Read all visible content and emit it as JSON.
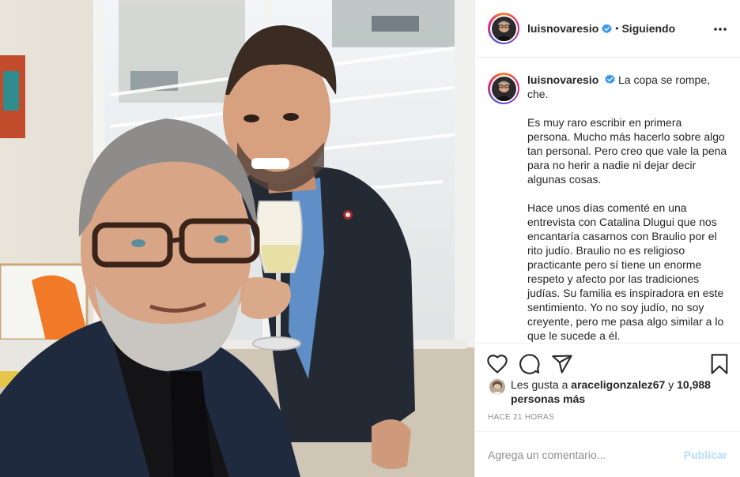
{
  "post": {
    "username": "luisnovaresio",
    "verified_icon": "verified-badge-icon",
    "separator": "•",
    "follow_state": "Siguiendo",
    "more_icon": "more-options-icon"
  },
  "caption": {
    "username": "luisnovaresio",
    "lead": "La copa se rompe, che.",
    "paragraphs": [
      "Es muy raro escribir en primera persona. Mucho más hacerlo sobre algo tan personal. Pero creo que vale la pena para no herir a nadie ni dejar decir algunas cosas.",
      "Hace unos días comenté en una entrevista con Catalina Dlugui que nos encantaría casarnos con Braulio por el rito judío. Braulio no es religioso practicante pero sí tiene un enorme respeto y afecto por las tradiciones judías. Su familia es inspiradora en este sentimiento. Yo no soy judío, no soy creyente, pero me pasa algo similar a lo que le sucede a él."
    ]
  },
  "actions": {
    "like_icon": "heart-icon",
    "comment_icon": "comment-icon",
    "share_icon": "share-icon",
    "save_icon": "bookmark-icon"
  },
  "likes": {
    "prefix": "Les gusta a",
    "user": "araceligonzalez67",
    "connector": "y",
    "count_text": "10,988 personas más"
  },
  "timestamp": "Hace 21 horas",
  "comment": {
    "placeholder": "Agrega un comentario...",
    "publish_label": "Publicar"
  },
  "colors": {
    "verified_blue": "#3897f0",
    "publish_disabled": "#b2dffc",
    "muted_text": "#8e8e8e",
    "border": "#efefef"
  }
}
